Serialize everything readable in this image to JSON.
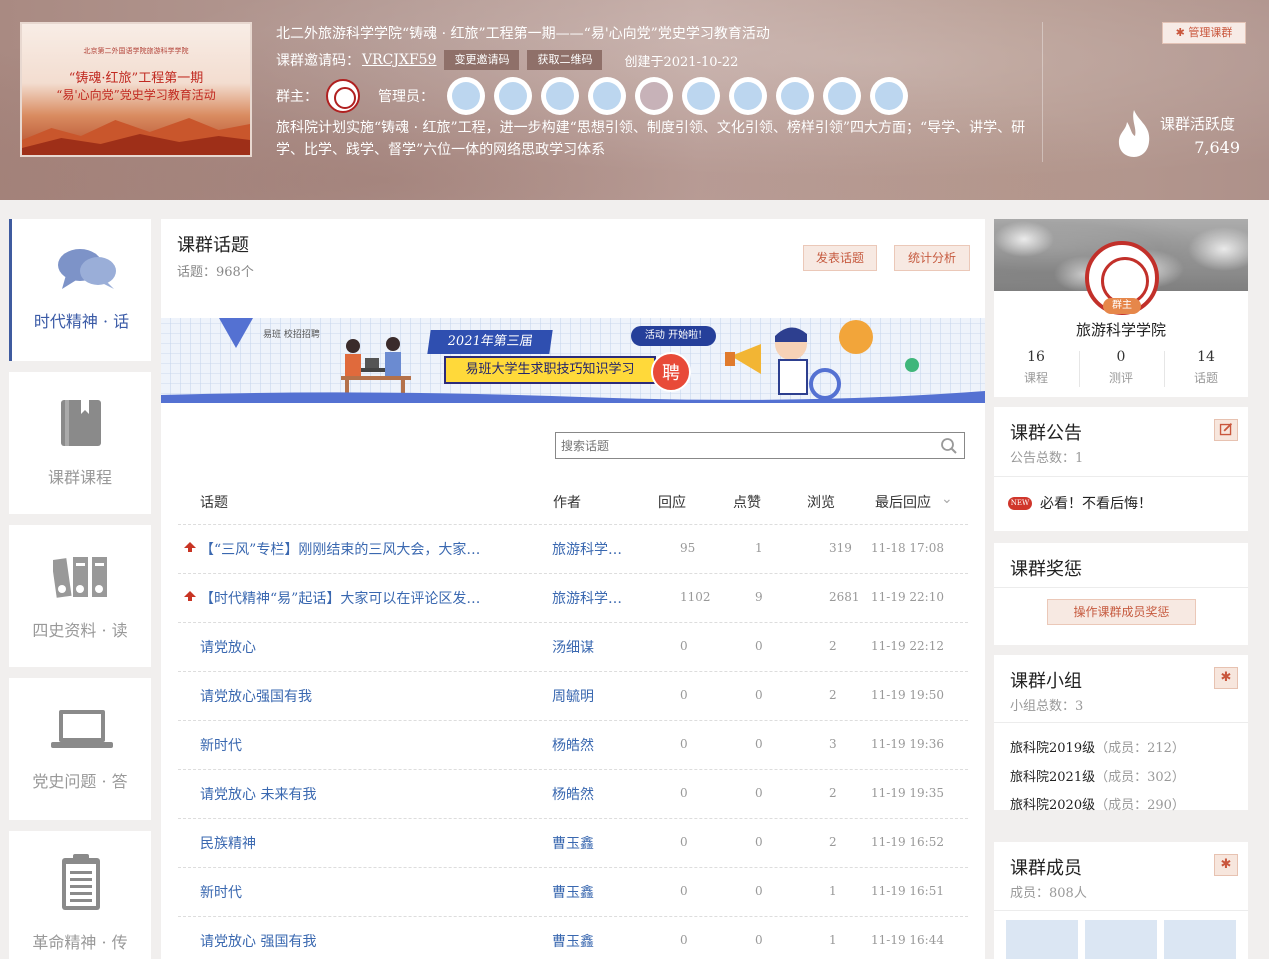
{
  "header": {
    "cover": {
      "small": "北京第二外国语学院旅游科学学院",
      "line1": "“铸魂·红旅”工程第一期",
      "line2": "“易'心向党”党史学习教育活动"
    },
    "title": "北二外旅游科学学院“铸魂 · 红旅”工程第一期——“易'心向党”党史学习教育活动",
    "invite_label": "课群邀请码：",
    "invite_code": "VRCJXF59",
    "change_code": "变更邀请码",
    "get_qr": "获取二维码",
    "created": "创建于2021-10-22",
    "owner_label": "群主：",
    "admins_label": "管理员：",
    "description": "旅科院计划实施“铸魂 · 红旅”工程，进一步构建“思想引领、制度引领、文化引领、榜样引领”四大方面；“导学、讲学、研学、比学、践学、督学”六位一体的网络思政学习体系",
    "manage_button": "管理课群",
    "activity_label": "课群活跃度",
    "activity_value": "7,649"
  },
  "leftnav": [
    {
      "label": "时代精神 · 话",
      "icon": "chat-bubbles-icon"
    },
    {
      "label": "课群课程",
      "icon": "book-icon"
    },
    {
      "label": "四史资料 · 读",
      "icon": "binders-icon"
    },
    {
      "label": "党史问题 · 答",
      "icon": "laptop-icon"
    },
    {
      "label": "革命精神 · 传",
      "icon": "clipboard-icon"
    }
  ],
  "main": {
    "title": "课群话题",
    "count": "话题：968个",
    "post_button": "发表话题",
    "stats_button": "统计分析",
    "banner": {
      "logos": "易班  校招招聘",
      "year": "2021年第三届",
      "main": "易班大学生求职技巧知识学习",
      "tag": "活动 开始啦!",
      "pin": "聘"
    },
    "search_placeholder": "搜索话题",
    "columns": {
      "topic": "话题",
      "author": "作者",
      "replies": "回应",
      "likes": "点赞",
      "views": "浏览",
      "last": "最后回应"
    },
    "rows": [
      {
        "topic": "【“三风”专栏】刚刚结束的三风大会，大家…",
        "author": "旅游科学…",
        "replies": "95",
        "likes": "1",
        "views": "319",
        "last": "11-18 17:08",
        "pinned": true
      },
      {
        "topic": "【时代精神“易”起话】大家可以在评论区发…",
        "author": "旅游科学…",
        "replies": "1102",
        "likes": "9",
        "views": "2681",
        "last": "11-19 22:10",
        "pinned": true
      },
      {
        "topic": "请党放心",
        "author": "汤细谋",
        "replies": "0",
        "likes": "0",
        "views": "2",
        "last": "11-19 22:12",
        "pinned": false
      },
      {
        "topic": "请党放心强国有我",
        "author": "周毓明",
        "replies": "0",
        "likes": "0",
        "views": "2",
        "last": "11-19 19:50",
        "pinned": false
      },
      {
        "topic": "新时代",
        "author": "杨皓然",
        "replies": "0",
        "likes": "0",
        "views": "3",
        "last": "11-19 19:36",
        "pinned": false
      },
      {
        "topic": "请党放心 未来有我",
        "author": "杨皓然",
        "replies": "0",
        "likes": "0",
        "views": "2",
        "last": "11-19 19:35",
        "pinned": false
      },
      {
        "topic": "民族精神",
        "author": "曹玉鑫",
        "replies": "0",
        "likes": "0",
        "views": "2",
        "last": "11-19 16:52",
        "pinned": false
      },
      {
        "topic": "新时代",
        "author": "曹玉鑫",
        "replies": "0",
        "likes": "0",
        "views": "1",
        "last": "11-19 16:51",
        "pinned": false
      },
      {
        "topic": "请党放心 强国有我",
        "author": "曹玉鑫",
        "replies": "0",
        "likes": "0",
        "views": "1",
        "last": "11-19 16:44",
        "pinned": false
      }
    ]
  },
  "profile": {
    "badge": "群主",
    "name": "旅游科学学院",
    "stats": [
      {
        "value": "16",
        "label": "课程"
      },
      {
        "value": "0",
        "label": "测评"
      },
      {
        "value": "14",
        "label": "话题"
      }
    ]
  },
  "notice": {
    "title": "课群公告",
    "count": "公告总数：1",
    "new_badge": "NEW",
    "item": "必看！不看后悔！"
  },
  "reward": {
    "title": "课群奖惩",
    "button": "操作课群成员奖惩"
  },
  "groups": {
    "title": "课群小组",
    "count": "小组总数：3",
    "items": [
      {
        "name": "旅科院2019级",
        "members": "（成员：212）"
      },
      {
        "name": "旅科院2021级",
        "members": "（成员：302）"
      },
      {
        "name": "旅科院2020级",
        "members": "（成员：290）"
      }
    ]
  },
  "members": {
    "title": "课群成员",
    "count": "成员：808人"
  }
}
